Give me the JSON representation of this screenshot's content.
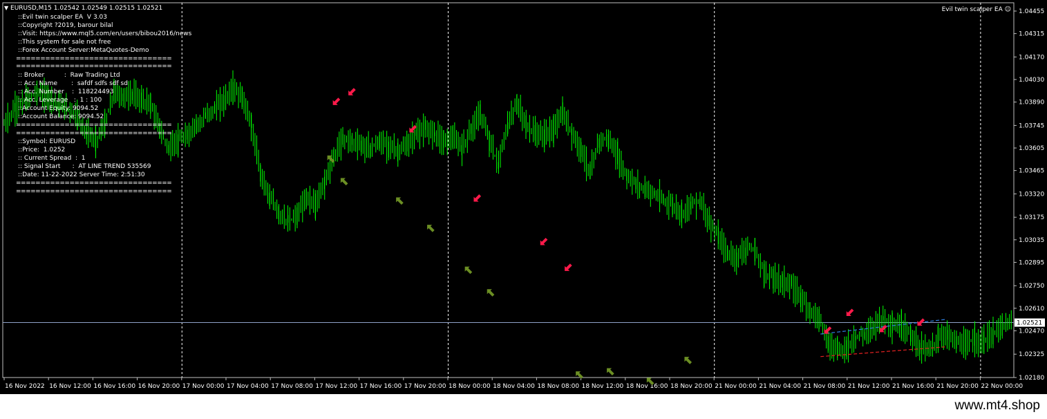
{
  "header": {
    "symbol_line": "EURUSD,M15  1.02542 1.02549 1.02515 1.02521",
    "ea_name": "Evil twin scalper EA",
    "ea_icon": "smiley-icon"
  },
  "info_panel": {
    "lines_a": [
      "::Evil twin scalper EA  V 3.03",
      "::Copyright ?2019, barour bilal",
      "::Visit: https://www.mql5.com/en/users/bibou2016/news",
      "::This system for sale not free",
      "::Forex Account Server:MetaQuotes-Demo"
    ],
    "lines_b": [
      ":: Broker          :  Raw Trading Ltd",
      ":: Acc. Name       :  safdf sdfs sdf sd",
      ":: Acc. Number    :  118224493",
      ":: Acc. Leverage   :  1 : 100",
      "::Account Equity: 9094.52",
      "::Account Balance: 9094.52"
    ],
    "lines_c": [
      "::Symbol: EURUSD",
      "::Price:  1.0252",
      ":: Current Spread  :  1",
      ":: Signal Start      :  AT LINE TREND 535569",
      "::Date: 11-22-2022 Server Time: 2:51:30"
    ],
    "separator": "================================"
  },
  "chart_data": {
    "type": "line",
    "symbol": "EURUSD",
    "timeframe": "M15",
    "ohlc": {
      "open": 1.02542,
      "high": 1.02549,
      "low": 1.02515,
      "close": 1.02521
    },
    "current_price_label": "1.02521",
    "y_ticks": [
      "1.04455",
      "1.04315",
      "1.04170",
      "1.04030",
      "1.03890",
      "1.03745",
      "1.03605",
      "1.03465",
      "1.03320",
      "1.03175",
      "1.03035",
      "1.02895",
      "1.02750",
      "1.02610",
      "1.02470",
      "1.02325",
      "1.02180"
    ],
    "ylim": [
      1.0218,
      1.04455
    ],
    "x_ticks": [
      "16 Nov 2022",
      "16 Nov 12:00",
      "16 Nov 16:00",
      "16 Nov 20:00",
      "17 Nov 00:00",
      "17 Nov 04:00",
      "17 Nov 08:00",
      "17 Nov 12:00",
      "17 Nov 16:00",
      "17 Nov 20:00",
      "18 Nov 00:00",
      "18 Nov 04:00",
      "18 Nov 08:00",
      "18 Nov 12:00",
      "18 Nov 16:00",
      "18 Nov 20:00",
      "21 Nov 00:00",
      "21 Nov 04:00",
      "21 Nov 08:00",
      "21 Nov 12:00",
      "21 Nov 16:00",
      "21 Nov 20:00",
      "22 Nov 00:00"
    ],
    "day_separators": [
      "17 Nov 00:00",
      "18 Nov 00:00",
      "21 Nov 00:00",
      "22 Nov 00:00"
    ],
    "price_path": [
      [
        0,
        1.0375
      ],
      [
        0.6,
        1.0385
      ],
      [
        1.2,
        1.039
      ],
      [
        1.8,
        1.0395
      ],
      [
        2.4,
        1.0392
      ],
      [
        3,
        1.0388
      ],
      [
        3.5,
        1.0385
      ],
      [
        4,
        1.038
      ],
      [
        4.5,
        1.037
      ],
      [
        5,
        1.0365
      ],
      [
        5.5,
        1.0375
      ],
      [
        6,
        1.0395
      ],
      [
        6.5,
        1.0392
      ],
      [
        7,
        1.0394
      ],
      [
        7.5,
        1.039
      ],
      [
        8,
        1.0388
      ],
      [
        8.5,
        1.0372
      ],
      [
        9,
        1.036
      ],
      [
        9.5,
        1.0365
      ],
      [
        10,
        1.0368
      ],
      [
        10.5,
        1.0375
      ],
      [
        11,
        1.038
      ],
      [
        11.5,
        1.0385
      ],
      [
        12,
        1.039
      ],
      [
        12.5,
        1.0397
      ],
      [
        13,
        1.0392
      ],
      [
        13.5,
        1.0375
      ],
      [
        14,
        1.0345
      ],
      [
        14.5,
        1.033
      ],
      [
        15,
        1.032
      ],
      [
        15.5,
        1.0315
      ],
      [
        16,
        1.0318
      ],
      [
        16.5,
        1.033
      ],
      [
        17,
        1.0325
      ],
      [
        17.5,
        1.034
      ],
      [
        18,
        1.0355
      ],
      [
        18.5,
        1.0366
      ],
      [
        19,
        1.0365
      ],
      [
        19.5,
        1.0362
      ],
      [
        20,
        1.036
      ],
      [
        20.5,
        1.0364
      ],
      [
        21,
        1.0362
      ],
      [
        21.5,
        1.0358
      ],
      [
        22,
        1.0362
      ],
      [
        22.5,
        1.037
      ],
      [
        23,
        1.0372
      ],
      [
        23.5,
        1.037
      ],
      [
        24,
        1.0365
      ],
      [
        24.5,
        1.0367
      ],
      [
        25,
        1.036
      ],
      [
        25.5,
        1.0372
      ],
      [
        26,
        1.0382
      ],
      [
        26.5,
        1.0365
      ],
      [
        27,
        1.035
      ],
      [
        27.5,
        1.0375
      ],
      [
        28,
        1.0388
      ],
      [
        28.5,
        1.0375
      ],
      [
        29,
        1.037
      ],
      [
        29.5,
        1.0368
      ],
      [
        30,
        1.0372
      ],
      [
        30.5,
        1.0382
      ],
      [
        31,
        1.037
      ],
      [
        31.5,
        1.036
      ],
      [
        32,
        1.0345
      ],
      [
        32.5,
        1.0365
      ],
      [
        33,
        1.0366
      ],
      [
        33.5,
        1.0355
      ],
      [
        34,
        1.0343
      ],
      [
        34.5,
        1.0338
      ],
      [
        35,
        1.0335
      ],
      [
        35.5,
        1.0332
      ],
      [
        36,
        1.0328
      ],
      [
        36.5,
        1.0325
      ],
      [
        37,
        1.032
      ],
      [
        37.5,
        1.0325
      ],
      [
        38,
        1.0328
      ],
      [
        38.5,
        1.0315
      ],
      [
        39,
        1.0305
      ],
      [
        39.5,
        1.0295
      ],
      [
        40,
        1.0292
      ],
      [
        40.5,
        1.0298
      ],
      [
        41,
        1.0297
      ],
      [
        41.5,
        1.0283
      ],
      [
        42,
        1.028
      ],
      [
        42.5,
        1.0278
      ],
      [
        43,
        1.0275
      ],
      [
        43.5,
        1.0268
      ],
      [
        44,
        1.026
      ],
      [
        44.5,
        1.0255
      ],
      [
        45,
        1.024
      ],
      [
        45.5,
        1.0235
      ],
      [
        46,
        1.0236
      ],
      [
        46.5,
        1.0243
      ],
      [
        47,
        1.0245
      ],
      [
        47.5,
        1.025
      ],
      [
        48,
        1.0255
      ],
      [
        48.5,
        1.025
      ],
      [
        49,
        1.025
      ],
      [
        49.5,
        1.0245
      ],
      [
        50,
        1.0237
      ],
      [
        50.5,
        1.0235
      ],
      [
        51,
        1.0242
      ],
      [
        51.5,
        1.0245
      ],
      [
        52,
        1.024
      ],
      [
        52.5,
        1.0238
      ],
      [
        53,
        1.0242
      ],
      [
        53.5,
        1.024
      ],
      [
        54,
        1.0245
      ],
      [
        54.5,
        1.025
      ],
      [
        55,
        1.0252
      ]
    ],
    "arrows_down": [
      [
        14.95,
        1.0389
      ],
      [
        15.65,
        1.0395
      ],
      [
        18.4,
        1.0372
      ],
      [
        21.3,
        1.0329
      ],
      [
        24.3,
        1.0302
      ],
      [
        25.4,
        1.0286
      ],
      [
        37.1,
        1.0247
      ],
      [
        38.1,
        1.0258
      ],
      [
        39.6,
        1.0248
      ],
      [
        41.3,
        1.0252
      ]
    ],
    "arrows_up": [
      [
        14.7,
        1.0354
      ],
      [
        15.3,
        1.034
      ],
      [
        17.8,
        1.0328
      ],
      [
        19.2,
        1.0311
      ],
      [
        20.9,
        1.0285
      ],
      [
        21.9,
        1.0271
      ],
      [
        25.9,
        1.022
      ],
      [
        27.3,
        1.0222
      ],
      [
        29.1,
        1.0216
      ],
      [
        30.8,
        1.0229
      ]
    ],
    "trend_line_upper": [
      [
        36.8,
        1.0245
      ],
      [
        42.4,
        1.0254
      ]
    ],
    "trend_line_lower": [
      [
        36.8,
        1.0231
      ],
      [
        42.4,
        1.0237
      ]
    ],
    "upper_line_color": "#2f7fe0",
    "lower_line_color": "#e02020",
    "candle_color": "#00ff00",
    "down_arrow_color": "#ff1a4a",
    "up_arrow_color": "#6b8e23",
    "grid": false
  },
  "footer": {
    "site": "www.mt4.shop"
  }
}
